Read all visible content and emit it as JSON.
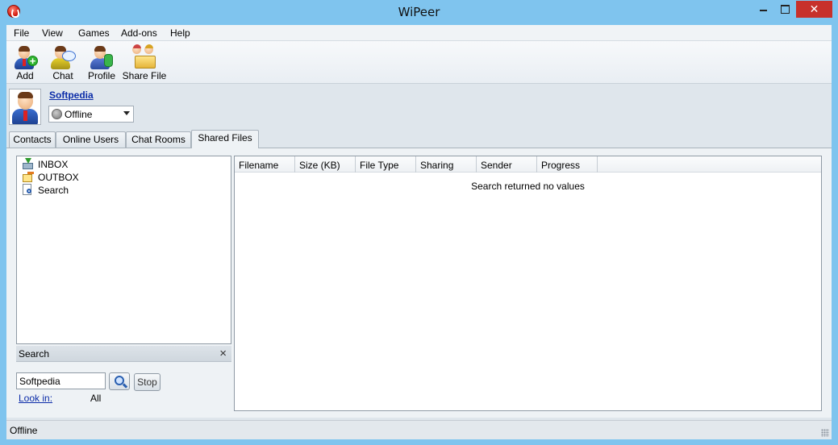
{
  "window": {
    "title": "WiPeer",
    "close_glyph": "✕"
  },
  "menu": [
    "File",
    "View",
    "Games",
    "Add-ons",
    "Help"
  ],
  "toolbar": [
    {
      "label": "Add",
      "icon": "add-contact-icon"
    },
    {
      "label": "Chat",
      "icon": "chat-icon"
    },
    {
      "label": "Profile",
      "icon": "profile-icon"
    },
    {
      "label": "Share File",
      "icon": "share-file-icon"
    }
  ],
  "user": {
    "name": "Softpedia",
    "status": "Offline"
  },
  "tabs": [
    "Contacts",
    "Online Users",
    "Chat Rooms",
    "Shared Files"
  ],
  "active_tab": "Shared Files",
  "tree": [
    {
      "label": "INBOX",
      "icon": "inbox-icon"
    },
    {
      "label": "OUTBOX",
      "icon": "outbox-icon"
    },
    {
      "label": "Search",
      "icon": "search-doc-icon"
    }
  ],
  "search": {
    "title": "Search",
    "close": "×",
    "query": "Softpedia",
    "stop_label": "Stop",
    "look_in_label": "Look in:",
    "look_in_value": "All"
  },
  "results": {
    "columns": [
      "Filename",
      "Size (KB)",
      "File Type",
      "Sharing",
      "Sender",
      "Progress"
    ],
    "empty_message": "Search returned no values"
  },
  "statusbar": {
    "text": "Offline"
  },
  "colors": {
    "frame": "#7fc4ee",
    "close": "#c7312b",
    "link": "#0b2ca8"
  }
}
